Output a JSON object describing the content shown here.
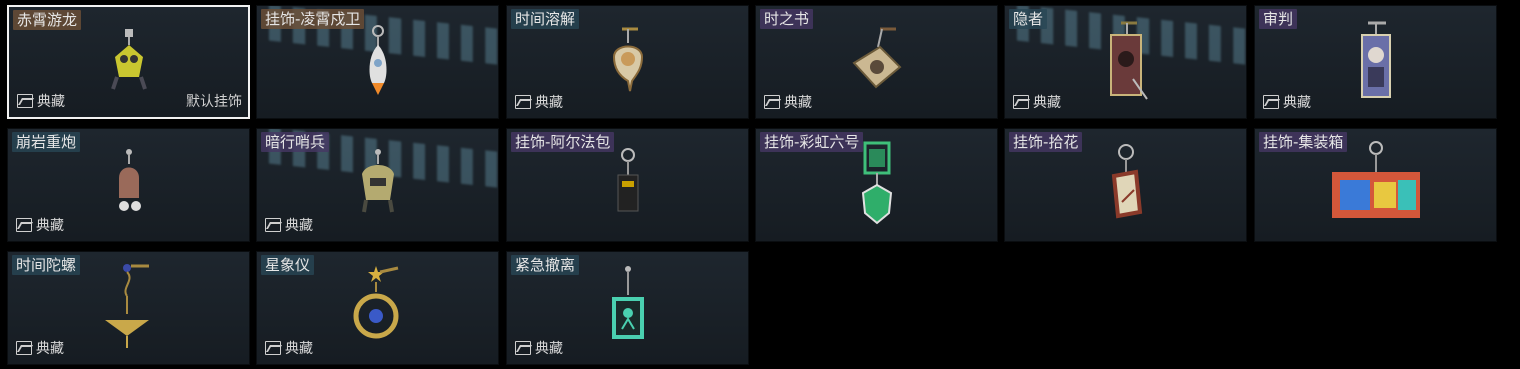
{
  "cards": [
    {
      "name": "赤霄游龙",
      "tag": "典藏",
      "default": "默认挂饰",
      "selected": true,
      "label_style": "brown",
      "icon": "dragon-charm-icon"
    },
    {
      "name": "挂饰-凌霄戍卫",
      "tag": "",
      "label_style": "brown",
      "icon": "rocket-charm-icon",
      "stripes": true
    },
    {
      "name": "时间溶解",
      "tag": "典藏",
      "label_style": "teal",
      "icon": "melting-clock-charm-icon"
    },
    {
      "name": "时之书",
      "tag": "典藏",
      "label_style": "purple",
      "icon": "book-charm-icon"
    },
    {
      "name": "隐者",
      "tag": "典藏",
      "label_style": "teal",
      "icon": "hermit-card-charm-icon",
      "stripes": true
    },
    {
      "name": "审判",
      "tag": "典藏",
      "label_style": "purple",
      "icon": "judgement-card-charm-icon"
    },
    {
      "name": "崩岩重炮",
      "tag": "典藏",
      "label_style": "teal",
      "icon": "rock-cannon-charm-icon"
    },
    {
      "name": "暗行哨兵",
      "tag": "典藏",
      "label_style": "purple",
      "icon": "sentinel-charm-icon",
      "stripes": true
    },
    {
      "name": "挂饰-阿尔法包",
      "tag": "",
      "label_style": "purple",
      "icon": "alpha-bag-charm-icon"
    },
    {
      "name": "挂饰-彩虹六号",
      "tag": "",
      "label_style": "purple",
      "icon": "rainbow-six-charm-icon"
    },
    {
      "name": "挂饰-拾花",
      "tag": "",
      "label_style": "purple",
      "icon": "flower-frame-charm-icon"
    },
    {
      "name": "挂饰-集装箱",
      "tag": "",
      "label_style": "purple",
      "icon": "container-charm-icon"
    },
    {
      "name": "时间陀螺",
      "tag": "典藏",
      "label_style": "teal",
      "icon": "spinning-top-charm-icon"
    },
    {
      "name": "星象仪",
      "tag": "典藏",
      "label_style": "teal",
      "icon": "astrolabe-charm-icon"
    },
    {
      "name": "紧急撤离",
      "tag": "典藏",
      "label_style": "teal",
      "icon": "emergency-exit-charm-icon"
    }
  ]
}
